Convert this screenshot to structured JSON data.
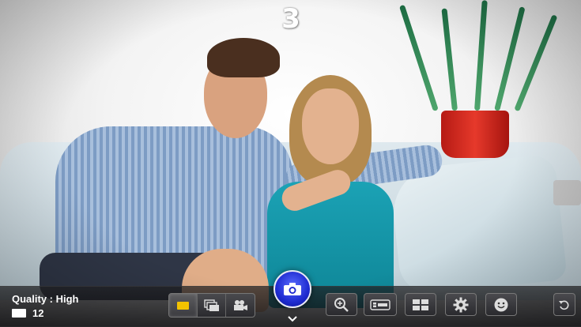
{
  "osd": {
    "shot_counter": "3",
    "quality_label": "Quality : High",
    "remaining_count": "12"
  },
  "toolbar": {
    "mode_group": [
      {
        "id": "single",
        "icon": "single-shot-icon",
        "selected": true
      },
      {
        "id": "burst",
        "icon": "burst-shot-icon",
        "selected": false
      },
      {
        "id": "video",
        "icon": "video-camera-icon",
        "selected": false
      }
    ],
    "capture_button_icon": "camera-icon",
    "right_buttons": [
      "zoom-in-icon",
      "remote-control-icon",
      "layout-grid-icon",
      "gear-icon",
      "smiley-icon"
    ],
    "return_button_icon": "return-icon",
    "expand_icon": "chevron-down-icon"
  },
  "colors": {
    "capture_button": "#1e2bd0",
    "selected_mode_indicator": "#f2c200",
    "toolbar_background": "#1e1e20"
  }
}
